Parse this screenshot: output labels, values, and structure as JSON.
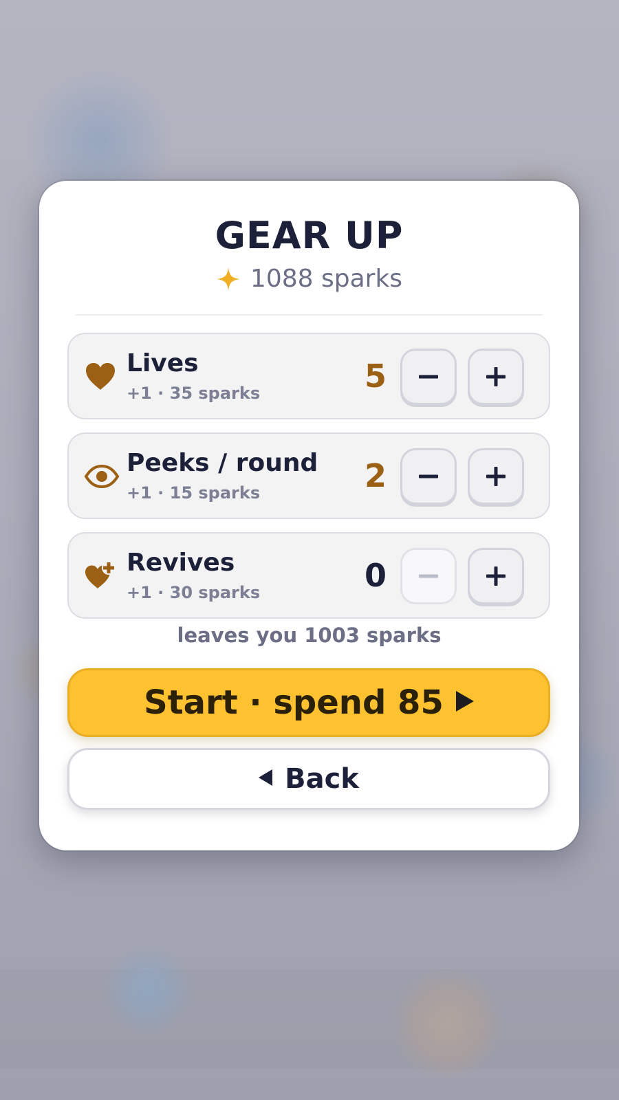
{
  "header": {
    "title": "GEAR UP",
    "balance_text": "1088 sparks",
    "balance_icon": "sparkle-icon"
  },
  "items": [
    {
      "name": "Lives",
      "cost_text": "+1 · 35 sparks",
      "count": "5",
      "icon": "heart-icon",
      "minus_enabled": true
    },
    {
      "name": "Peeks / round",
      "cost_text": "+1 · 15 sparks",
      "count": "2",
      "icon": "eye-icon",
      "minus_enabled": true
    },
    {
      "name": "Revives",
      "cost_text": "+1 · 30 sparks",
      "count": "0",
      "icon": "heart-plus-icon",
      "minus_enabled": false
    }
  ],
  "summary": {
    "leftover_text": "leaves you 1003 sparks"
  },
  "actions": {
    "start_label": "Start · spend 85",
    "back_label": "Back"
  },
  "colors": {
    "accent_brown": "#9b6014",
    "gold": "#f0ae22",
    "start_button": "#fec12f",
    "text_dark": "#1c2039",
    "text_muted": "#6b6e85"
  }
}
